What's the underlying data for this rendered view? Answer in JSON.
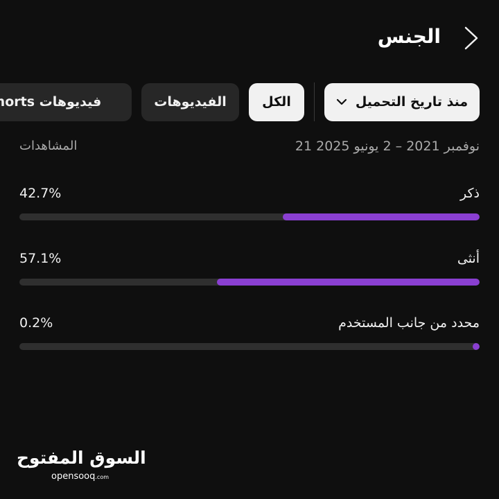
{
  "header": {
    "title": "الجنس",
    "back_icon": "chevron-right-icon"
  },
  "filters": {
    "date_chip": "منذ تاريخ التحميل",
    "chips": {
      "all": "الكل",
      "videos": "الفيديوهات",
      "shorts": "فيديوهات Shorts"
    },
    "selected": "all"
  },
  "meta": {
    "date_range": "21 نوفمبر 2021 – 2 يونيو 2025",
    "views_label": "المشاهدات"
  },
  "breakdown": [
    {
      "label": "ذكر",
      "value": "42.7%",
      "fraction": 0.427
    },
    {
      "label": "أنثى",
      "value": "57.1%",
      "fraction": 0.571
    },
    {
      "label": "محدد من جانب المستخدم",
      "value": "0.2%",
      "fraction": 0.002
    }
  ],
  "colors": {
    "bar_fill": "#8a3fd1",
    "bar_track": "#2f2f2f",
    "background": "#0f0f0f"
  },
  "watermark": {
    "arabic": "السوق المفتوح",
    "latin": "opensooq",
    "suffix": ".com"
  }
}
